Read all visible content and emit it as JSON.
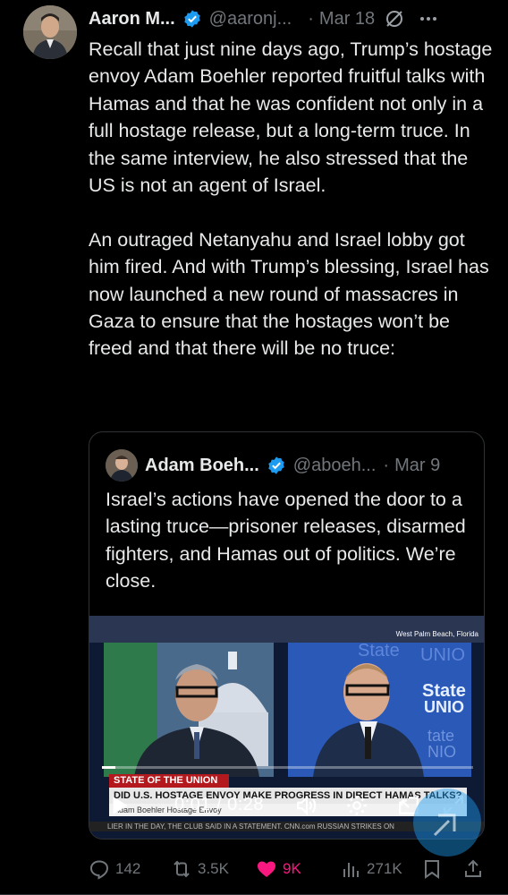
{
  "tweet": {
    "author_name": "Aaron M...",
    "author_handle": "@aaronj...",
    "separator": "·",
    "date": "Mar 18",
    "text": "Recall that just nine days ago, Trump’s hostage envoy Adam Boehler reported fruitful talks with Hamas and that he was confident not only in a full hostage release, but a long-term truce. In the same interview, he also stressed that the US is not an agent of Israel.\n\nAn outraged Netanyahu and Israel lobby got him fired. And with Trump’s blessing, Israel has now launched a new round of massacres in Gaza to ensure that the hostages won’t be freed and that there will be no truce:",
    "icons": [
      "verified-badge-icon",
      "grok-icon",
      "more-icon"
    ]
  },
  "quoted_tweet": {
    "author_name": "Adam Boeh...",
    "author_handle": "@aboeh...",
    "separator": "·",
    "date": "Mar 9",
    "text": "Israel’s actions have opened the door to a lasting truce—prisoner releases, disarmed fighters, and Hamas out of politics. We’re close."
  },
  "video": {
    "location_caption": "West Palm Beach, Florida",
    "banner_red": "STATE OF THE UNION",
    "banner_headline": "DID U.S. HOSTAGE ENVOY MAKE PROGRESS IN DIRECT HAMAS TALKS?",
    "banner_sub": "Adam Boehler Hostage Envoy",
    "ticker": "LIER IN THE DAY, THE CLUB SAID IN A STATEMENT.   CNN.com   RUSSIAN STRIKES ON",
    "time_display": "0:01 / 0:28",
    "progress": 0.036,
    "icons": [
      "play-icon",
      "volume-icon",
      "settings-icon",
      "pip-icon",
      "fullscreen-icon"
    ]
  },
  "actions": {
    "replies": "142",
    "reposts": "3.5K",
    "likes": "9K",
    "views": "271K",
    "icons": [
      "reply-icon",
      "repost-icon",
      "like-icon",
      "views-icon",
      "bookmark-icon",
      "share-icon"
    ]
  },
  "colors": {
    "background": "#000000",
    "text": "#e7e9ea",
    "secondary": "#71767b",
    "verified": "#1d9bf0",
    "like": "#f91880",
    "border": "#2f3336"
  }
}
